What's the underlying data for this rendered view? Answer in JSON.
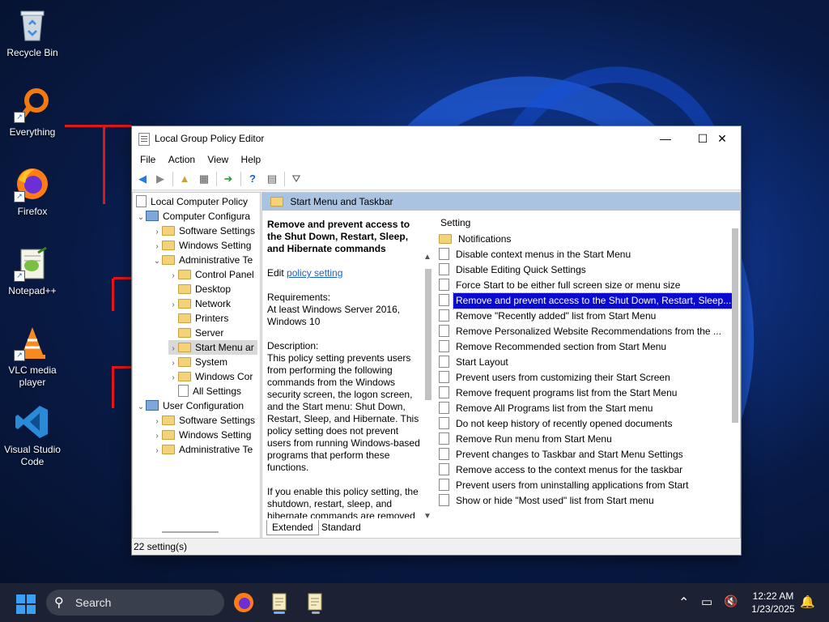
{
  "desktop": {
    "icons": [
      {
        "label": "Recycle Bin"
      },
      {
        "label": "Everything"
      },
      {
        "label": "Firefox"
      },
      {
        "label": "Notepad++"
      },
      {
        "label": "VLC media player"
      },
      {
        "label": "Visual Studio Code"
      }
    ]
  },
  "window": {
    "title": "Local Group Policy Editor",
    "controls": {
      "minimize": "—",
      "maximize": "☐",
      "close": "✕"
    },
    "menu": [
      "File",
      "Action",
      "View",
      "Help"
    ],
    "tree": [
      {
        "label": "Local Computer Policy",
        "icon": "computer-icon"
      },
      {
        "label": "Computer Configura",
        "icon": "computer-icon"
      },
      {
        "label": "Software Settings",
        "icon": "folder-icon"
      },
      {
        "label": "Windows Setting",
        "icon": "folder-icon"
      },
      {
        "label": "Administrative Te",
        "icon": "folder-icon"
      },
      {
        "label": "Control Panel",
        "icon": "folder-icon"
      },
      {
        "label": "Desktop",
        "icon": "folder-icon"
      },
      {
        "label": "Network",
        "icon": "folder-icon"
      },
      {
        "label": "Printers",
        "icon": "folder-icon"
      },
      {
        "label": "Server",
        "icon": "folder-icon"
      },
      {
        "label": "Start Menu ar",
        "icon": "folder-icon"
      },
      {
        "label": "System",
        "icon": "folder-icon"
      },
      {
        "label": "Windows Cor",
        "icon": "folder-icon"
      },
      {
        "label": "All Settings",
        "icon": "settings-icon"
      },
      {
        "label": "User Configuration",
        "icon": "computer-icon"
      },
      {
        "label": "Software Settings",
        "icon": "folder-icon"
      },
      {
        "label": "Windows Setting",
        "icon": "folder-icon"
      },
      {
        "label": "Administrative Te",
        "icon": "folder-icon"
      }
    ],
    "header": "Start Menu and Taskbar",
    "description": {
      "title": "Remove and prevent access to the Shut Down, Restart, Sleep, and Hibernate commands",
      "edit_prefix": "Edit",
      "edit_link": "policy setting",
      "requirements_label": "Requirements:",
      "requirements": "At least Windows Server 2016, Windows 10",
      "description_label": "Description:",
      "body": "This policy setting prevents users from performing the following commands from the Windows security screen, the logon screen, and the Start menu: Shut Down, Restart, Sleep, and Hibernate. This policy setting does not prevent users from running Windows-based programs that perform these functions.",
      "body2": "If you enable this policy setting, the shutdown, restart, sleep, and hibernate commands are removed"
    },
    "list_header": "Setting",
    "settings": [
      "Notifications",
      "Disable context menus in the Start Menu",
      "Disable Editing Quick Settings",
      "Force Start to be either full screen size or menu size",
      "Remove and prevent access to the Shut Down, Restart, Sleep...",
      "Remove \"Recently added\" list from Start Menu",
      "Remove Personalized Website Recommendations from the ...",
      "Remove Recommended section from Start Menu",
      "Start Layout",
      "Prevent users from customizing their Start Screen",
      "Remove frequent programs list from the Start Menu",
      "Remove All Programs list from the Start menu",
      "Do not keep history of recently opened documents",
      "Remove Run menu from Start Menu",
      "Prevent changes to Taskbar and Start Menu Settings",
      "Remove access to the context menus for the taskbar",
      "Prevent users from uninstalling applications from Start",
      "Show or hide \"Most used\" list from Start menu"
    ],
    "tabs": [
      "Extended",
      "Standard"
    ],
    "status": "22 setting(s)"
  },
  "taskbar": {
    "search_text": "Search",
    "time": "12:22 AM",
    "date": "1/23/2025"
  }
}
